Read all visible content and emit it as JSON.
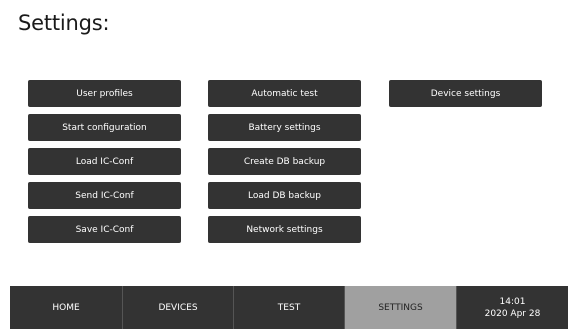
{
  "page": {
    "title": "Settings:"
  },
  "buttons": {
    "user_profiles": "User profiles",
    "start_configuration": "Start configuration",
    "load_ic_conf": "Load IC-Conf",
    "send_ic_conf": "Send IC-Conf",
    "save_ic_conf": "Save IC-Conf",
    "automatic_test": "Automatic test",
    "battery_settings": "Battery settings",
    "create_db_backup": "Create DB backup",
    "load_db_backup": "Load DB backup",
    "network_settings": "Network settings",
    "device_settings": "Device settings"
  },
  "navbar": {
    "home": "HOME",
    "devices": "DEVICES",
    "test": "TEST",
    "settings": "SETTINGS",
    "active": "SETTINGS",
    "clock_time": "14:01",
    "clock_date": "2020 Apr 28"
  },
  "colors": {
    "button_bg": "#333333",
    "button_text": "#ffffff",
    "nav_active_bg": "#a0a0a0"
  }
}
